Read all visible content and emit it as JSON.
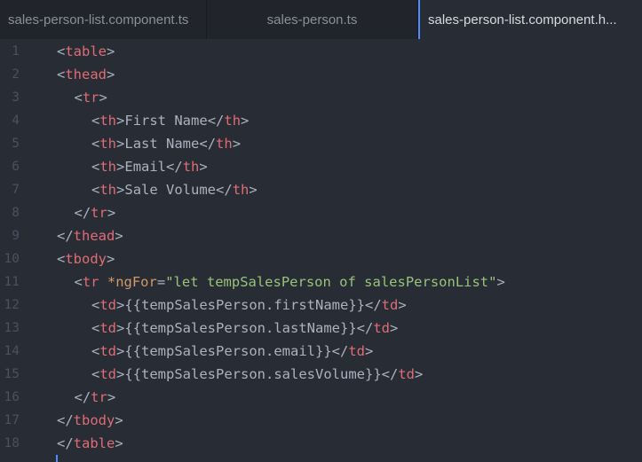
{
  "tabs": [
    {
      "label": "sales-person-list.component.ts",
      "active": false
    },
    {
      "label": "sales-person.ts",
      "active": false
    },
    {
      "label": "sales-person-list.component.h...",
      "active": true
    }
  ],
  "colors": {
    "background": "#282c34",
    "tag": "#e06c75",
    "attribute": "#d19a66",
    "string": "#98c379",
    "text": "#abb2bf",
    "line_number": "#495162",
    "accent": "#528bff"
  },
  "editor": {
    "lines": [
      {
        "n": "1",
        "indent": 0,
        "tokens": [
          [
            "pun",
            "<"
          ],
          [
            "tag",
            "table"
          ],
          [
            "pun",
            ">"
          ]
        ]
      },
      {
        "n": "2",
        "indent": 0,
        "tokens": [
          [
            "pun",
            "<"
          ],
          [
            "tag",
            "thead"
          ],
          [
            "pun",
            ">"
          ]
        ]
      },
      {
        "n": "3",
        "indent": 1,
        "tokens": [
          [
            "pun",
            "<"
          ],
          [
            "tag",
            "tr"
          ],
          [
            "pun",
            ">"
          ]
        ]
      },
      {
        "n": "4",
        "indent": 2,
        "tokens": [
          [
            "pun",
            "<"
          ],
          [
            "tag",
            "th"
          ],
          [
            "pun",
            ">"
          ],
          [
            "txt",
            "First Name"
          ],
          [
            "pun",
            "</"
          ],
          [
            "tag",
            "th"
          ],
          [
            "pun",
            ">"
          ]
        ]
      },
      {
        "n": "5",
        "indent": 2,
        "tokens": [
          [
            "pun",
            "<"
          ],
          [
            "tag",
            "th"
          ],
          [
            "pun",
            ">"
          ],
          [
            "txt",
            "Last Name"
          ],
          [
            "pun",
            "</"
          ],
          [
            "tag",
            "th"
          ],
          [
            "pun",
            ">"
          ]
        ]
      },
      {
        "n": "6",
        "indent": 2,
        "tokens": [
          [
            "pun",
            "<"
          ],
          [
            "tag",
            "th"
          ],
          [
            "pun",
            ">"
          ],
          [
            "txt",
            "Email"
          ],
          [
            "pun",
            "</"
          ],
          [
            "tag",
            "th"
          ],
          [
            "pun",
            ">"
          ]
        ]
      },
      {
        "n": "7",
        "indent": 2,
        "tokens": [
          [
            "pun",
            "<"
          ],
          [
            "tag",
            "th"
          ],
          [
            "pun",
            ">"
          ],
          [
            "txt",
            "Sale Volume"
          ],
          [
            "pun",
            "</"
          ],
          [
            "tag",
            "th"
          ],
          [
            "pun",
            ">"
          ]
        ]
      },
      {
        "n": "8",
        "indent": 1,
        "tokens": [
          [
            "pun",
            "</"
          ],
          [
            "tag",
            "tr"
          ],
          [
            "pun",
            ">"
          ]
        ]
      },
      {
        "n": "9",
        "indent": 0,
        "tokens": [
          [
            "pun",
            "</"
          ],
          [
            "tag",
            "thead"
          ],
          [
            "pun",
            ">"
          ]
        ]
      },
      {
        "n": "10",
        "indent": 0,
        "tokens": [
          [
            "pun",
            "<"
          ],
          [
            "tag",
            "tbody"
          ],
          [
            "pun",
            ">"
          ]
        ]
      },
      {
        "n": "11",
        "indent": 1,
        "tokens": [
          [
            "pun",
            "<"
          ],
          [
            "tag",
            "tr"
          ],
          [
            "pun",
            " "
          ],
          [
            "attr",
            "*ngFor"
          ],
          [
            "pun",
            "="
          ],
          [
            "str",
            "\"let tempSalesPerson of salesPersonList\""
          ],
          [
            "pun",
            ">"
          ]
        ]
      },
      {
        "n": "12",
        "indent": 2,
        "tokens": [
          [
            "pun",
            "<"
          ],
          [
            "tag",
            "td"
          ],
          [
            "pun",
            ">"
          ],
          [
            "txt",
            "{{tempSalesPerson.firstName}}"
          ],
          [
            "pun",
            "</"
          ],
          [
            "tag",
            "td"
          ],
          [
            "pun",
            ">"
          ]
        ]
      },
      {
        "n": "13",
        "indent": 2,
        "tokens": [
          [
            "pun",
            "<"
          ],
          [
            "tag",
            "td"
          ],
          [
            "pun",
            ">"
          ],
          [
            "txt",
            "{{tempSalesPerson.lastName}}"
          ],
          [
            "pun",
            "</"
          ],
          [
            "tag",
            "td"
          ],
          [
            "pun",
            ">"
          ]
        ]
      },
      {
        "n": "14",
        "indent": 2,
        "tokens": [
          [
            "pun",
            "<"
          ],
          [
            "tag",
            "td"
          ],
          [
            "pun",
            ">"
          ],
          [
            "txt",
            "{{tempSalesPerson.email}}"
          ],
          [
            "pun",
            "</"
          ],
          [
            "tag",
            "td"
          ],
          [
            "pun",
            ">"
          ]
        ]
      },
      {
        "n": "15",
        "indent": 2,
        "tokens": [
          [
            "pun",
            "<"
          ],
          [
            "tag",
            "td"
          ],
          [
            "pun",
            ">"
          ],
          [
            "txt",
            "{{tempSalesPerson.salesVolume}}"
          ],
          [
            "pun",
            "</"
          ],
          [
            "tag",
            "td"
          ],
          [
            "pun",
            ">"
          ]
        ]
      },
      {
        "n": "16",
        "indent": 1,
        "tokens": [
          [
            "pun",
            "</"
          ],
          [
            "tag",
            "tr"
          ],
          [
            "pun",
            ">"
          ]
        ]
      },
      {
        "n": "17",
        "indent": 0,
        "tokens": [
          [
            "pun",
            "</"
          ],
          [
            "tag",
            "tbody"
          ],
          [
            "pun",
            ">"
          ]
        ]
      },
      {
        "n": "18",
        "indent": 0,
        "tokens": [
          [
            "pun",
            "</"
          ],
          [
            "tag",
            "table"
          ],
          [
            "pun",
            ">"
          ]
        ]
      }
    ]
  }
}
